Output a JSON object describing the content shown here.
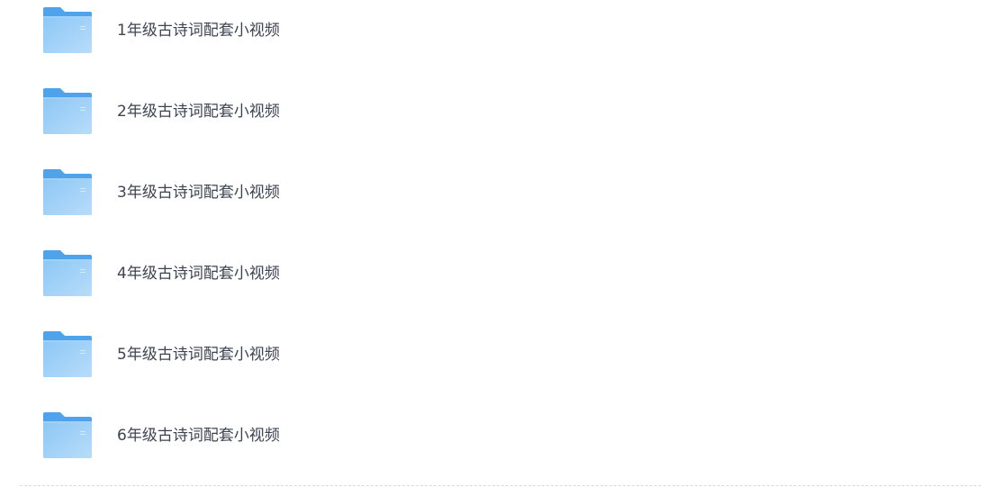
{
  "folders": [
    {
      "name": "1年级古诗词配套小视频",
      "icon": "folder-icon"
    },
    {
      "name": "2年级古诗词配套小视频",
      "icon": "folder-icon"
    },
    {
      "name": "3年级古诗词配套小视频",
      "icon": "folder-icon"
    },
    {
      "name": "4年级古诗词配套小视频",
      "icon": "folder-icon"
    },
    {
      "name": "5年级古诗词配套小视频",
      "icon": "folder-icon"
    },
    {
      "name": "6年级古诗词配套小视频",
      "icon": "folder-icon"
    }
  ],
  "colors": {
    "folder_back": "#4ea3ea",
    "folder_front_top": "#8cc7f5",
    "folder_front_bottom": "#b8dcfa",
    "text": "#3d4352",
    "divider": "#d6dbe3"
  }
}
